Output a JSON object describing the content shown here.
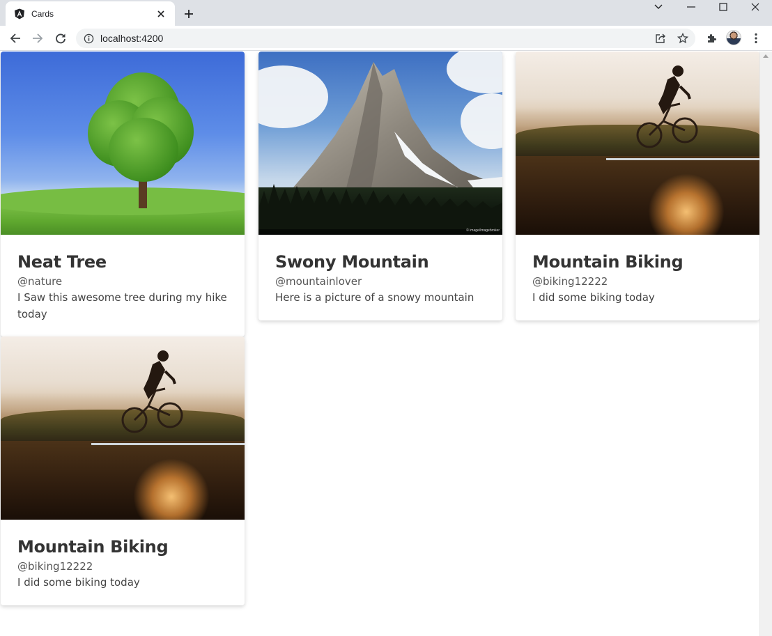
{
  "browser": {
    "tab_title": "Cards",
    "url": "localhost:4200"
  },
  "cards": [
    {
      "image": "tree",
      "title": "Neat Tree",
      "handle": "@nature",
      "text": "I Saw this awesome tree during my hike today"
    },
    {
      "image": "mountain",
      "title": "Swony Mountain",
      "handle": "@mountainlover",
      "text": "Here is a picture of a snowy mountain"
    },
    {
      "image": "mountain-biker",
      "title": "Mountain Biking",
      "handle": "@biking12222",
      "text": "I did some biking today"
    },
    {
      "image": "mountain-biker",
      "title": "Mountain Biking",
      "handle": "@biking12222",
      "text": "I did some biking today"
    }
  ]
}
